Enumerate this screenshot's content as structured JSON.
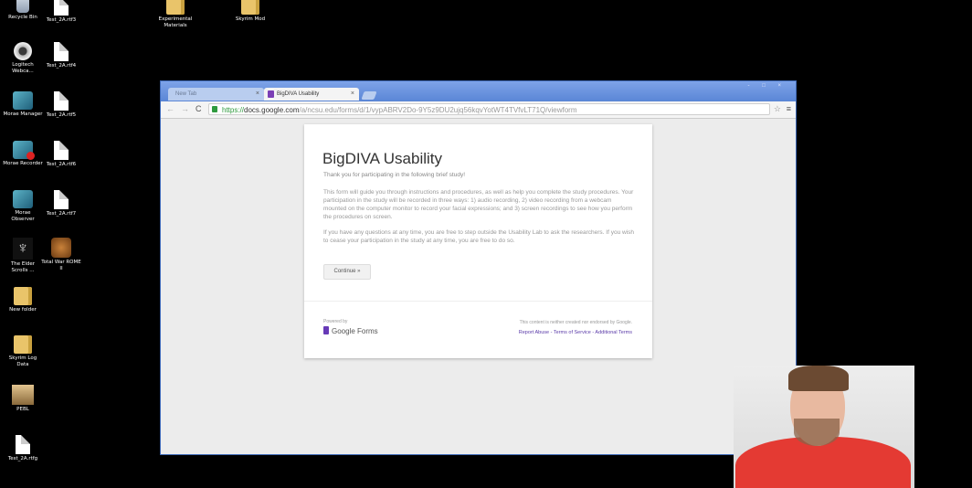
{
  "desktop": {
    "icons": [
      {
        "label": "Recycle Bin",
        "icon": "recycle-bin-icon"
      },
      {
        "label": "Test_2A.rtf3",
        "icon": "document-icon"
      },
      {
        "label": "Experimental Materials",
        "icon": "folder-icon"
      },
      {
        "label": "Skyrim Mod",
        "icon": "folder-icon"
      },
      {
        "label": "Logitech Webca...",
        "icon": "webcam-icon"
      },
      {
        "label": "Test_2A.rtf4",
        "icon": "document-icon"
      },
      {
        "label": "Morae Manager",
        "icon": "morae-manager-icon"
      },
      {
        "label": "Test_2A.rtf5",
        "icon": "document-icon"
      },
      {
        "label": "Morae Recorder",
        "icon": "morae-recorder-icon"
      },
      {
        "label": "Test_2A.rtf6",
        "icon": "document-icon"
      },
      {
        "label": "Morae Observer",
        "icon": "morae-observer-icon"
      },
      {
        "label": "Test_2A.rtf7",
        "icon": "document-icon"
      },
      {
        "label": "The Elder Scrolls ...",
        "icon": "skyrim-icon"
      },
      {
        "label": "Total War ROME II",
        "icon": "rome-icon"
      },
      {
        "label": "New folder",
        "icon": "folder-icon"
      },
      {
        "label": "Skyrim Log Data",
        "icon": "folder-icon"
      },
      {
        "label": "PEBL",
        "icon": "pebl-icon"
      },
      {
        "label": "Test_2A.rtfg",
        "icon": "document-icon"
      }
    ]
  },
  "browser": {
    "tabs": [
      {
        "label": "New Tab",
        "close": "×"
      },
      {
        "label": "BigDIVA Usability",
        "close": "×"
      }
    ],
    "window_controls": "- □ ×",
    "nav": {
      "back": "←",
      "forward": "→",
      "reload": "C"
    },
    "url": {
      "scheme": "https://",
      "host": "docs.google.com",
      "path": "/a/ncsu.edu/forms/d/1/vypABRV2Do-9Y5z9DU2ujq56kqvYotWT4TVfvLT71Q/viewform"
    },
    "star": "☆",
    "menu": "≡"
  },
  "form": {
    "title": "BigDIVA Usability",
    "subtitle": "Thank you for participating in the following brief study!",
    "paragraph1": "This form will guide you through instructions and procedures, as well as help you complete the study procedures. Your participation in the study will be recorded in three ways: 1) audio recording, 2) video recording from a webcam mounted on the computer monitor to record your facial expressions; and 3) screen recordings to see how you perform the procedures on screen.",
    "paragraph2": "If you have any questions at any time, you are free to step outside the Usability Lab to ask the researchers. If you wish to cease your participation in the study at any time, you are free to do so.",
    "continue_label": "Continue »",
    "powered_by": "Powered by",
    "logo_text": "Google Forms",
    "disclaimer": "This content is neither created nor endorsed by Google.",
    "links": "Report Abuse - Terms of Service - Additional Terms"
  }
}
